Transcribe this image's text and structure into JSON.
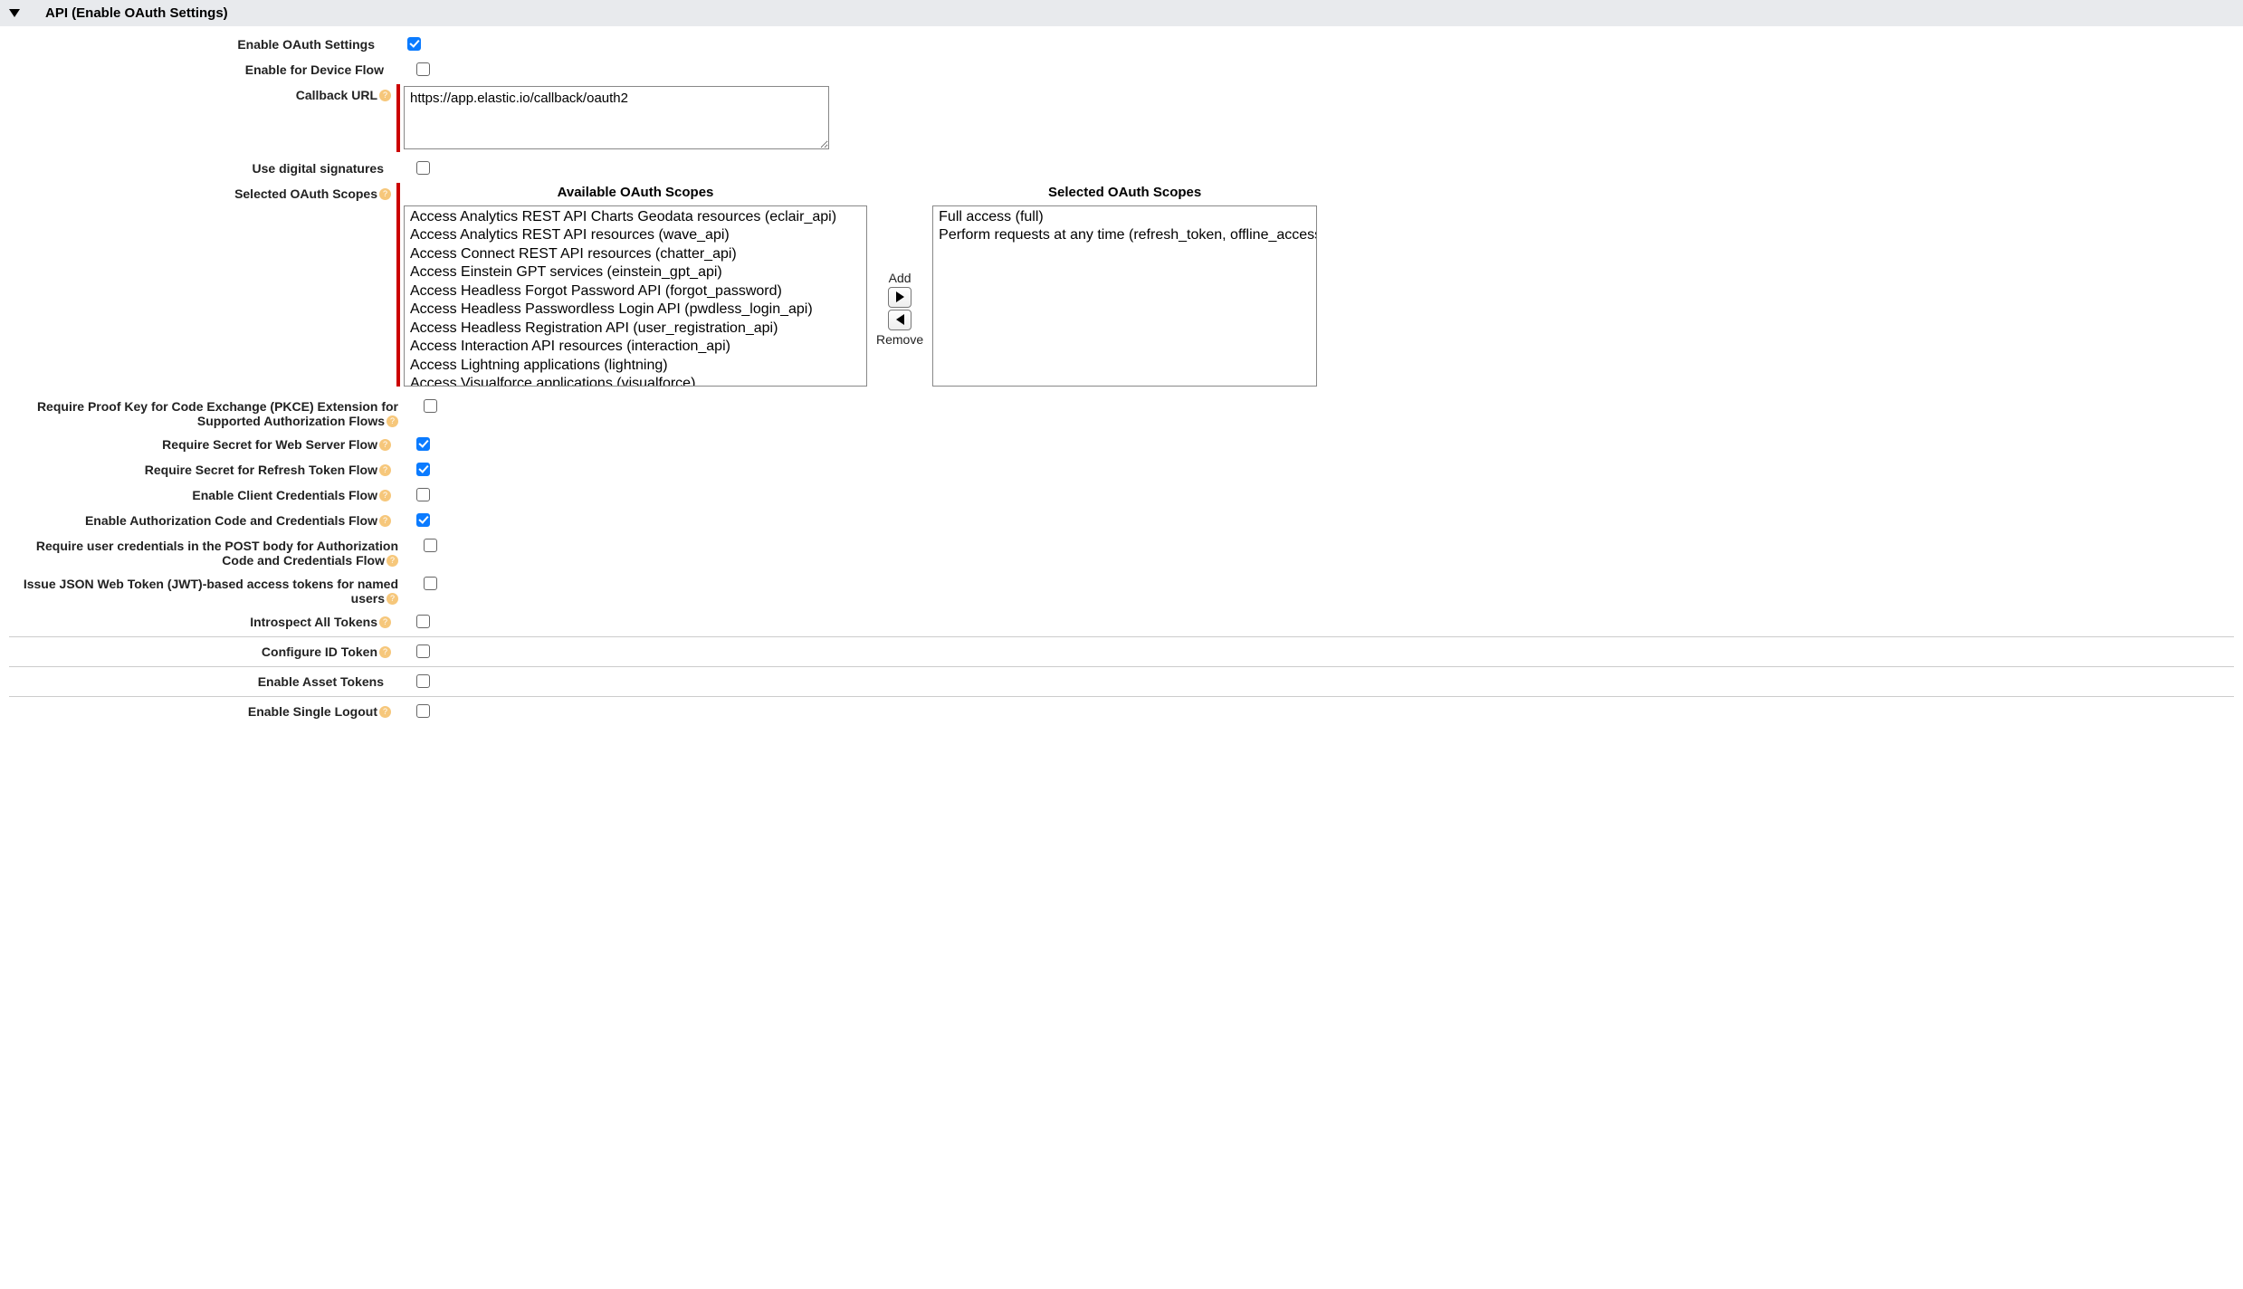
{
  "section_title": "API (Enable OAuth Settings)",
  "fields": {
    "enable_oauth_label": "Enable OAuth Settings",
    "enable_device_flow_label": "Enable for Device Flow",
    "callback_url_label": "Callback URL",
    "callback_url_value": "https://app.elastic.io/callback/oauth2",
    "digital_sig_label": "Use digital signatures",
    "selected_scopes_label": "Selected OAuth Scopes",
    "available_scopes_title": "Available OAuth Scopes",
    "selected_scopes_title": "Selected OAuth Scopes",
    "add_label": "Add",
    "remove_label": "Remove",
    "pkce_label": "Require Proof Key for Code Exchange (PKCE) Extension for Supported Authorization Flows",
    "web_server_secret_label": "Require Secret for Web Server Flow",
    "refresh_secret_label": "Require Secret for Refresh Token Flow",
    "client_credentials_label": "Enable Client Credentials Flow",
    "auth_code_creds_label": "Enable Authorization Code and Credentials Flow",
    "post_body_creds_label": "Require user credentials in the POST body for Authorization Code and Credentials Flow",
    "jwt_label": "Issue JSON Web Token (JWT)-based access tokens for named users",
    "introspect_label": "Introspect All Tokens",
    "configure_id_label": "Configure ID Token",
    "asset_tokens_label": "Enable Asset Tokens",
    "single_logout_label": "Enable Single Logout"
  },
  "available_scopes": [
    "Access Analytics REST API Charts Geodata resources (eclair_api)",
    "Access Analytics REST API resources (wave_api)",
    "Access Connect REST API resources (chatter_api)",
    "Access Einstein GPT services (einstein_gpt_api)",
    "Access Headless Forgot Password API (forgot_password)",
    "Access Headless Passwordless Login API (pwdless_login_api)",
    "Access Headless Registration API (user_registration_api)",
    "Access Interaction API resources (interaction_api)",
    "Access Lightning applications (lightning)",
    "Access Visualforce applications (visualforce)"
  ],
  "selected_scopes": [
    "Full access (full)",
    "Perform requests at any time (refresh_token, offline_access)"
  ],
  "checked": {
    "enable_oauth": true,
    "enable_device_flow": false,
    "digital_sig": false,
    "pkce": false,
    "web_server_secret": true,
    "refresh_secret": true,
    "client_credentials": false,
    "auth_code_creds": true,
    "post_body_creds": false,
    "jwt": false,
    "introspect": false,
    "configure_id": false,
    "asset_tokens": false,
    "single_logout": false
  }
}
